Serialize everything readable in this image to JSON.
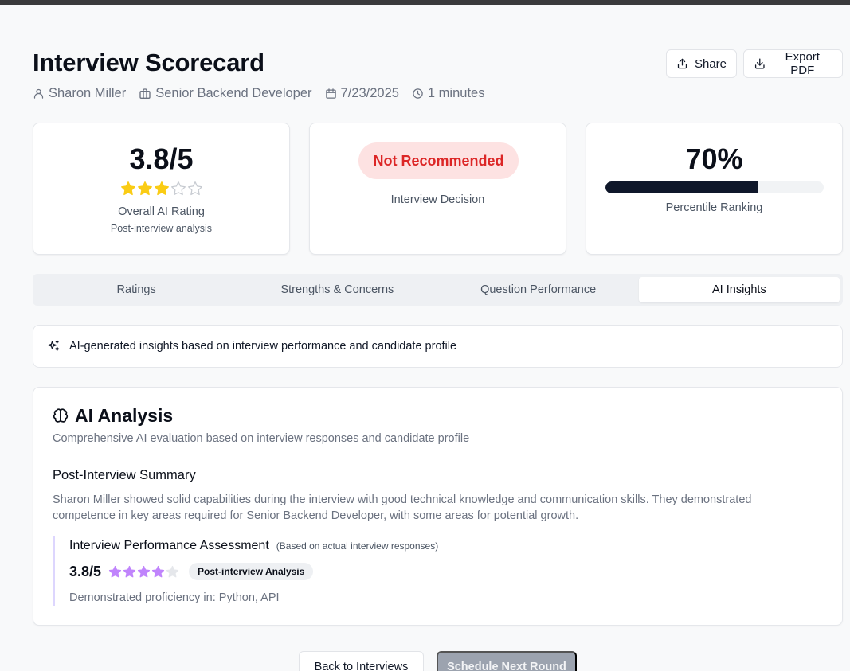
{
  "header": {
    "title": "Interview Scorecard",
    "candidate": "Sharon Miller",
    "role": "Senior Backend Developer",
    "date": "7/23/2025",
    "duration": "1 minutes",
    "share_label": "Share",
    "export_label": "Export PDF"
  },
  "cards": {
    "rating": {
      "value": "3.8/5",
      "stars": 3,
      "max_stars": 5,
      "label": "Overall AI Rating",
      "sublabel": "Post-interview analysis"
    },
    "decision": {
      "badge": "Not Recommended",
      "label": "Interview Decision"
    },
    "percentile": {
      "value": "70%",
      "fraction": 0.7,
      "label": "Percentile Ranking"
    }
  },
  "tabs": [
    {
      "label": "Ratings",
      "active": false
    },
    {
      "label": "Strengths & Concerns",
      "active": false
    },
    {
      "label": "Question Performance",
      "active": false
    },
    {
      "label": "AI Insights",
      "active": true
    }
  ],
  "notice": {
    "text": "AI-generated insights based on interview performance and candidate profile"
  },
  "analysis": {
    "title": "AI Analysis",
    "subtitle": "Comprehensive AI evaluation based on interview responses and candidate profile",
    "summary_heading": "Post-Interview Summary",
    "summary_text": "Sharon Miller showed solid capabilities during the interview with good technical knowledge and communication skills. They demonstrated competence in key areas required for Senior Backend Developer, with some areas for potential growth.",
    "assessment": {
      "title": "Interview Performance Assessment",
      "note": "(Based on actual interview responses)",
      "score": "3.8/5",
      "stars": 4,
      "max_stars": 5,
      "pill": "Post-interview Analysis",
      "proficiency": "Demonstrated proficiency in: Python, API"
    }
  },
  "footer": {
    "back_label": "Back to Interviews",
    "next_label": "Schedule Next Round"
  },
  "colors": {
    "star_gold": "#facc15",
    "star_purple": "#c084fc",
    "decision_bg": "#fde2e2",
    "decision_text": "#dc2626",
    "progress": "#0f172a",
    "accent_border": "#ddd6fe"
  }
}
